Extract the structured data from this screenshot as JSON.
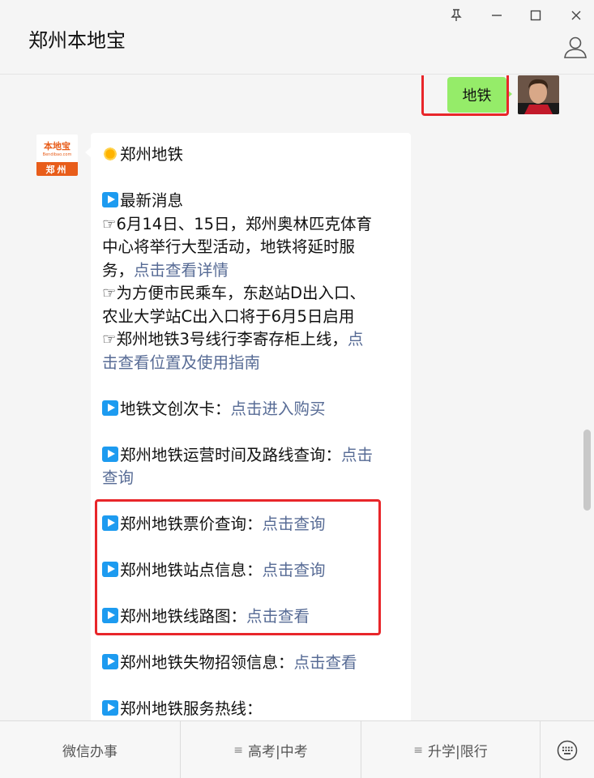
{
  "window": {
    "title": "郑州本地宝",
    "pin_icon": "pin-icon",
    "minimize_icon": "minimize-icon",
    "maximize_icon": "maximize-icon",
    "close_icon": "close-icon",
    "profile_icon": "person-icon"
  },
  "outgoing": {
    "text": "地铁",
    "highlight_color": "#e8262a"
  },
  "bot": {
    "avatar_brand": "本地宝",
    "avatar_domain": "Bendibao.com",
    "avatar_city": "郑州"
  },
  "message": {
    "header": "郑州地铁",
    "news_title": "最新消息",
    "news1_l1": "☞6月14日、15日，郑州奥林匹克体育",
    "news1_l2": "中心将举行大型活动，地铁将延时服",
    "news1_l3": "务，",
    "news1_link": "点击查看详情",
    "news2_l1": "☞为方便市民乘车，东赵站D出入口、",
    "news2_l2": "农业大学站C出入口将于6月5日启用",
    "news3_l1": "☞郑州地铁3号线行李寄存柜上线，",
    "news3_link1": "点",
    "news3_link2": "击查看位置及使用指南",
    "card_label": "地铁文创次卡：",
    "card_link": "点击进入购买",
    "hours_label": "郑州地铁运营时间及路线查询：",
    "hours_link1": "点击",
    "hours_link2": "查询",
    "fare_label": "郑州地铁票价查询：",
    "fare_link": "点击查询",
    "station_label": "郑州地铁站点信息：",
    "station_link": "点击查询",
    "map_label": "郑州地铁线路图：",
    "map_link": "点击查看",
    "lost_label": "郑州地铁失物招领信息：",
    "lost_link": "点击查看",
    "hotline_label": "郑州地铁服务热线："
  },
  "bottom_menu": {
    "item1": "微信办事",
    "item2": "高考|中考",
    "item3": "升学|限行",
    "keyboard_icon": "keyboard-icon"
  },
  "colors": {
    "link": "#576b95",
    "bubble_out": "#95ec69",
    "highlight": "#e8262a"
  }
}
